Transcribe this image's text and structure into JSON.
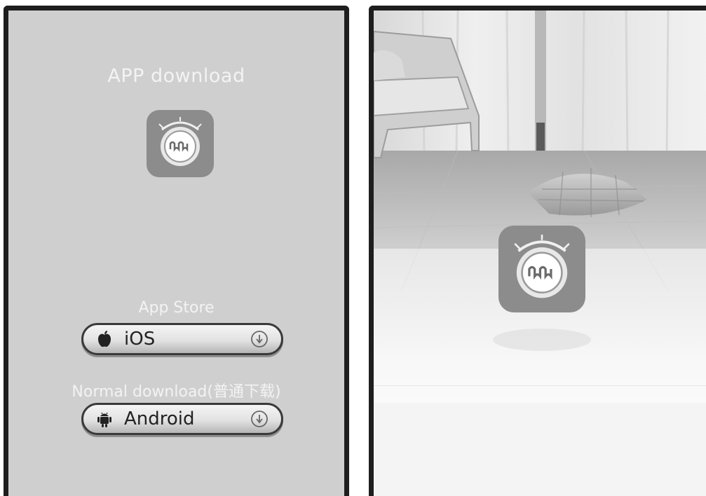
{
  "left_screen": {
    "title": "APP download",
    "app_store_label": "App Store",
    "ios_button_label": "iOS",
    "normal_download_label": "Normal download(普通下载)",
    "android_button_label": "Android"
  },
  "icons": {
    "app_icon": "robot-vacuum-app-icon",
    "ios": "apple-icon",
    "android": "android-icon",
    "download": "download-arrow-icon"
  },
  "colors": {
    "left_background": "#cfcfcf",
    "app_icon_background": "#8c8c8c",
    "frame": "#1e1e1e"
  }
}
